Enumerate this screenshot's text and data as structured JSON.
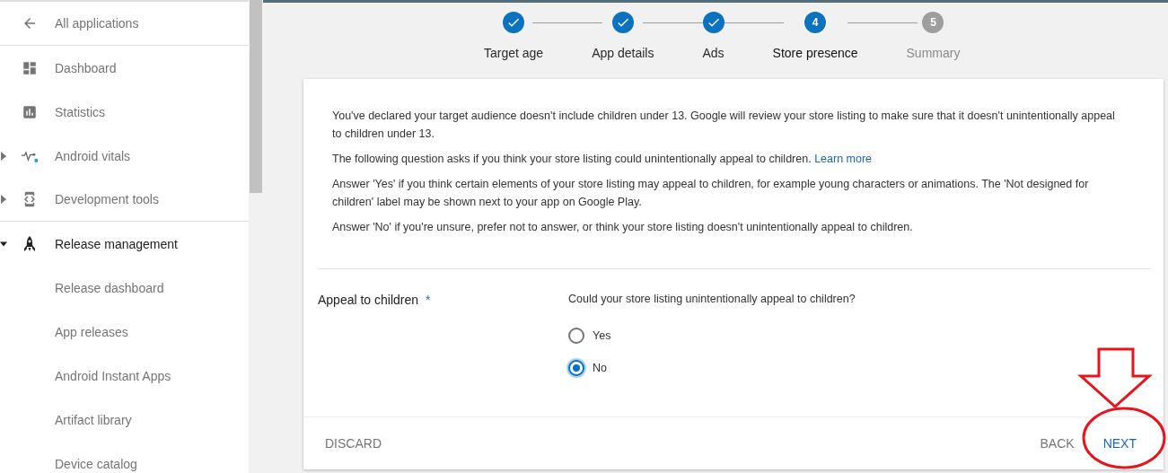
{
  "sidebar": {
    "back_item": {
      "label": "All applications"
    },
    "items": [
      {
        "label": "Dashboard",
        "selected": false
      },
      {
        "label": "Statistics",
        "selected": false
      },
      {
        "label": "Android vitals",
        "selected": false,
        "expanded": false,
        "badge_dot": true
      },
      {
        "label": "Development tools",
        "selected": false,
        "expanded": false
      },
      {
        "label": "Release management",
        "selected": true,
        "expanded": true,
        "children": [
          {
            "label": "Release dashboard"
          },
          {
            "label": "App releases"
          },
          {
            "label": "Android Instant Apps"
          },
          {
            "label": "Artifact library"
          },
          {
            "label": "Device catalog"
          }
        ]
      }
    ]
  },
  "stepper": [
    {
      "label": "Target age",
      "completed": true,
      "selected": false
    },
    {
      "label": "App details",
      "completed": true,
      "selected": false
    },
    {
      "label": "Ads",
      "completed": true,
      "selected": false
    },
    {
      "label": "Store presence",
      "completed": false,
      "selected": true,
      "number": "4"
    },
    {
      "label": "Summary",
      "completed": false,
      "selected": false,
      "number": "5"
    }
  ],
  "intro": [
    {
      "text": "You've declared your target audience doesn't include children under 13. Google will review your store listing to make sure that it doesn't unintentionally appeal to children under 13."
    },
    {
      "text": "The following question asks if you think your store listing could unintentionally appeal to children.",
      "link": "Learn more"
    },
    {
      "text": "Answer 'Yes' if you think certain elements of your store listing may appeal to children, for example young characters or animations. The 'Not designed for children' label may be shown next to your app on Google Play."
    },
    {
      "text": "Answer 'No' if you're unsure, prefer not to answer, or think your store listing doesn't unintentionally appeal to children."
    }
  ],
  "question": {
    "label": "Appeal to children",
    "required_mark": "*",
    "prompt": "Could your store listing unintentionally appeal to children?",
    "options": [
      {
        "label": "Yes",
        "selected": false
      },
      {
        "label": "No",
        "selected": true
      }
    ]
  },
  "footer": {
    "discard": "DISCARD",
    "back": "BACK",
    "next": "NEXT"
  }
}
